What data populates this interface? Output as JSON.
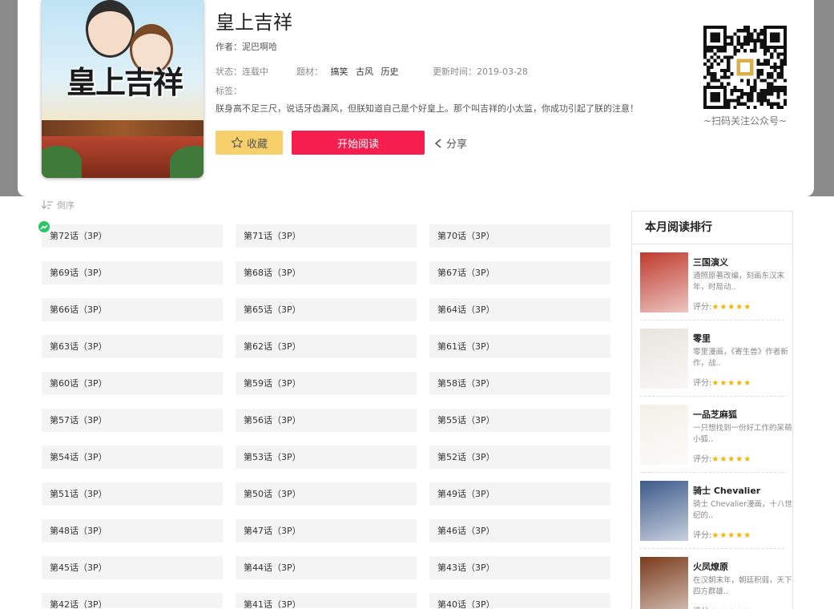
{
  "book": {
    "title": "皇上吉祥",
    "cover_title": "皇上吉祥",
    "author_label": "作者：",
    "author": "泥巴啊哈",
    "status_label": "状态：",
    "status": "连载中",
    "genre_label": "题材：",
    "genres": [
      "搞笑",
      "古风",
      "历史"
    ],
    "update_label": "更新时间：",
    "update_date": "2019-03-28",
    "tags_label": "标签：",
    "summary": "朕身高不足三尺，说话牙齿漏风，但朕知道自己是个好皇上。那个叫吉祥的小太监，你成功引起了朕的注意！"
  },
  "actions": {
    "favorite": "收藏",
    "read": "开始阅读",
    "share": "分享"
  },
  "qr": {
    "caption": "~扫码关注公众号~"
  },
  "sort": {
    "label": "倒序"
  },
  "chapters": [
    "第72话（3P）",
    "第71话（3P）",
    "第70话（3P）",
    "第69话（3P）",
    "第68话（3P）",
    "第67话（3P）",
    "第66话（3P）",
    "第65话（3P）",
    "第64话（3P）",
    "第63话（3P）",
    "第62话（3P）",
    "第61话（3P）",
    "第60话（3P）",
    "第59话（3P）",
    "第58话（3P）",
    "第57话（3P）",
    "第56话（3P）",
    "第55话（3P）",
    "第54话（3P）",
    "第53话（3P）",
    "第52话（3P）",
    "第51话（3P）",
    "第50话（3P）",
    "第49话（3P）",
    "第48话（3P）",
    "第47话（3P）",
    "第46话（3P）",
    "第45话（3P）",
    "第44话（3P）",
    "第43话（3P）",
    "第42话（3P）",
    "第41话（3P）",
    "第40话（3P）"
  ],
  "ranking": {
    "title": "本月阅读排行",
    "score_label": "评分:",
    "stars": "★★★★★",
    "items": [
      {
        "name": "三国演义",
        "desc": "通照原著改编，刻画东汉末年，时局动..",
        "thumb_color": "#c0392b"
      },
      {
        "name": "零里",
        "desc": "零里漫画，《寄生兽》作者新作，战..",
        "thumb_color": "#e8e4de"
      },
      {
        "name": "一品芝麻狐",
        "desc": "一只想找到一份好工作的呆萌小狐..",
        "thumb_color": "#f3f0e8"
      },
      {
        "name": "骑士 Chevalier",
        "desc": "骑士 Chevalier漫画，十八世纪的..",
        "thumb_color": "#3d5a8a"
      },
      {
        "name": "火凤燎原",
        "desc": "在汉朝末年，朝廷积弱，天下四方群雄..",
        "thumb_color": "#7a3a1a"
      }
    ]
  },
  "colors": {
    "primary": "#f51e4f",
    "favorite": "#f7d06b",
    "star": "#f5b400",
    "new_badge": "#28c466"
  }
}
